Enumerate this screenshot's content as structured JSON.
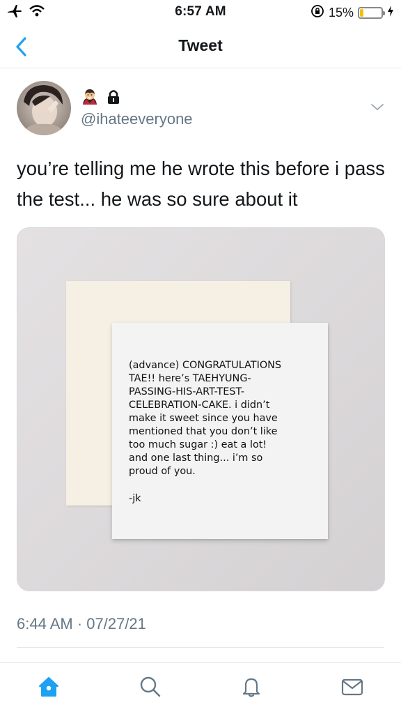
{
  "status_bar": {
    "time": "6:57 AM",
    "battery_percent_label": "15%",
    "battery_level": 0.15,
    "icons": [
      "airplane-icon",
      "wifi-icon",
      "orientation-lock-icon",
      "battery-icon",
      "charging-bolt-icon"
    ]
  },
  "nav": {
    "title": "Tweet",
    "back_icon": "chevron-left-icon"
  },
  "tweet": {
    "handle": "@ihateeveryone",
    "name_icons": [
      "vampire-emoji",
      "lock-icon"
    ],
    "text": "you’re telling me he wrote this before i pass the test... he was so sure about it",
    "timestamp": "6:44 AM · 07/27/21",
    "media": {
      "note_text": "(advance) CONGRATULATIONS\nTAE!! here’s TAEHYUNG-\nPASSING-HIS-ART-TEST-\nCELEBRATION-CAKE. i didn’t\nmake it sweet since you have\nmentioned that you don’t like\ntoo much sugar :) eat a lot!\nand one last thing... i’m so\nproud of you.",
      "note_signature": "-jk"
    }
  },
  "tab_bar": {
    "tabs": [
      "home-icon",
      "search-icon",
      "notifications-icon",
      "messages-icon"
    ]
  },
  "colors": {
    "accent": "#1da1f2",
    "secondary_text": "#657786",
    "divider": "#e1e8ed",
    "battery_low": "#f2c300"
  }
}
